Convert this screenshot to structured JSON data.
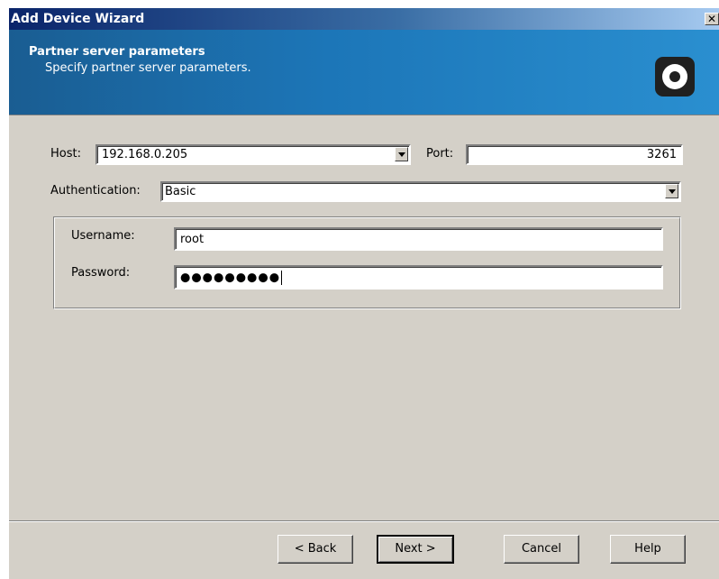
{
  "window": {
    "title": "Add Device Wizard",
    "close_glyph": "✕"
  },
  "banner": {
    "title": "Partner server parameters",
    "subtitle": "Specify partner server parameters.",
    "logo_icon": "wizard-logo-icon"
  },
  "form": {
    "host_label": "Host:",
    "host_value": "192.168.0.205",
    "port_label": "Port:",
    "port_value": "3261",
    "auth_label": "Authentication:",
    "auth_value": "Basic",
    "username_label": "Username:",
    "username_value": "root",
    "password_label": "Password:",
    "password_mask": "●●●●●●●●●"
  },
  "buttons": {
    "back": "< Back",
    "next": "Next >",
    "cancel": "Cancel",
    "help": "Help"
  }
}
